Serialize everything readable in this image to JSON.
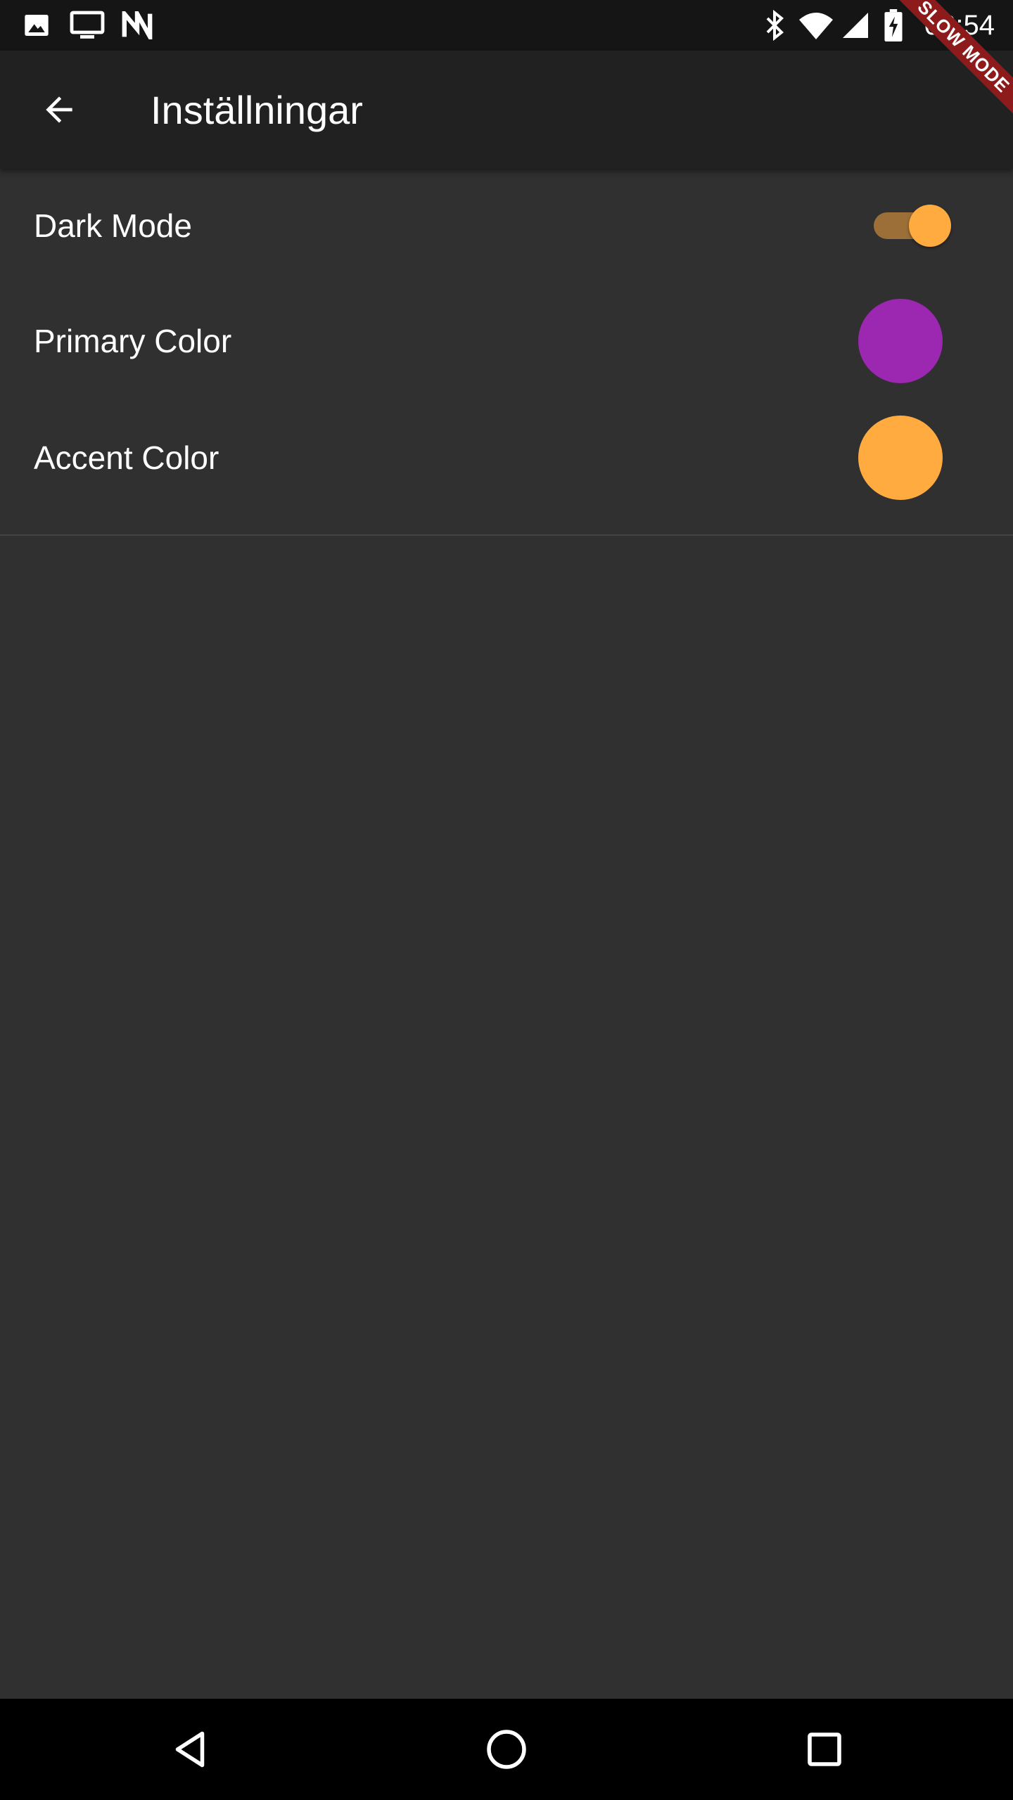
{
  "status_bar": {
    "time": "08:54",
    "left_icons": [
      "image-icon",
      "cast-icon",
      "n-app-icon"
    ],
    "right_icons": [
      "bluetooth-icon",
      "wifi-icon",
      "cell-signal-icon",
      "battery-charging-icon"
    ]
  },
  "debug_banner": {
    "label": "SLOW MODE"
  },
  "app_bar": {
    "back_icon": "arrow-back-icon",
    "title": "Inställningar"
  },
  "settings": {
    "dark_mode": {
      "label": "Dark Mode",
      "enabled": true
    },
    "primary_color": {
      "label": "Primary Color",
      "color": "#9c27b0"
    },
    "accent_color": {
      "label": "Accent Color",
      "color": "#ffab40"
    }
  },
  "nav_bar": {
    "icons": [
      "back-triangle-icon",
      "home-circle-icon",
      "recents-square-icon"
    ]
  }
}
